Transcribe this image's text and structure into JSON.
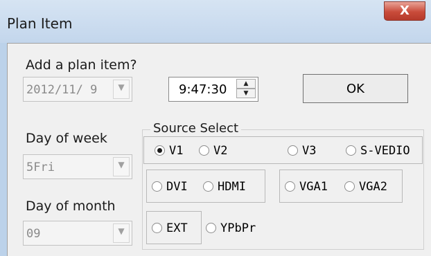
{
  "window": {
    "title": "Plan Item",
    "close_label": "X"
  },
  "date": {
    "label": "Add a plan item?",
    "value": "2012/11/ 9"
  },
  "time": {
    "value": "9:47:30"
  },
  "ok_label": "OK",
  "day_of_week": {
    "label": "Day of week",
    "value": "5Fri"
  },
  "day_of_month": {
    "label": "Day of month",
    "value": "09"
  },
  "source": {
    "label": "Source Select",
    "selected": "V1",
    "options": [
      "V1",
      "V2",
      "V3",
      "S-VEDIO",
      "DVI",
      "HDMI",
      "VGA1",
      "VGA2",
      "EXT",
      "YPbPr"
    ]
  },
  "icons": {
    "dropdown": "chevron-down-icon",
    "spin_up": "spin-up-icon",
    "spin_down": "spin-down-icon",
    "close": "close-icon"
  }
}
